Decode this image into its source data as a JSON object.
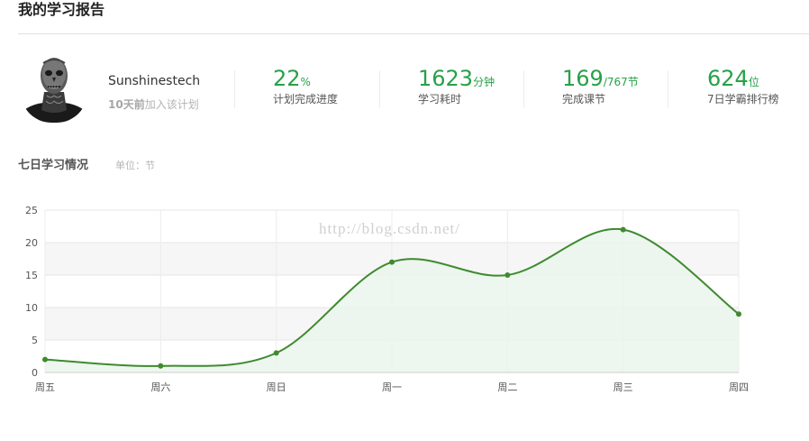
{
  "page": {
    "title": "我的学习报告"
  },
  "profile": {
    "username": "Sunshinestech",
    "join_days": "10天前",
    "join_text": "加入该计划"
  },
  "stats": [
    {
      "value": "22",
      "unit": "%",
      "label": "计划完成进度"
    },
    {
      "value": "1623",
      "unit": "分钟",
      "label": "学习耗时"
    },
    {
      "value": "169",
      "unit": "/767节",
      "label": "完成课节"
    },
    {
      "value": "624",
      "unit": "位",
      "label": "7日学霸排行榜"
    }
  ],
  "section": {
    "title": "七日学习情况",
    "unit_note": "单位：节"
  },
  "watermark": "http://blog.csdn.net/",
  "colors": {
    "accent": "#27a147",
    "line": "#3f8a2f",
    "area": "#eaf5ec",
    "band": "#f6f6f6"
  },
  "chart_data": {
    "type": "area",
    "categories": [
      "周五",
      "周六",
      "周日",
      "周一",
      "周二",
      "周三",
      "周四"
    ],
    "values": [
      2,
      1,
      3,
      17,
      15,
      22,
      9
    ],
    "ylim": [
      0,
      25
    ],
    "yticks": [
      0,
      5,
      10,
      15,
      20,
      25
    ],
    "grid": true,
    "smooth": true
  }
}
